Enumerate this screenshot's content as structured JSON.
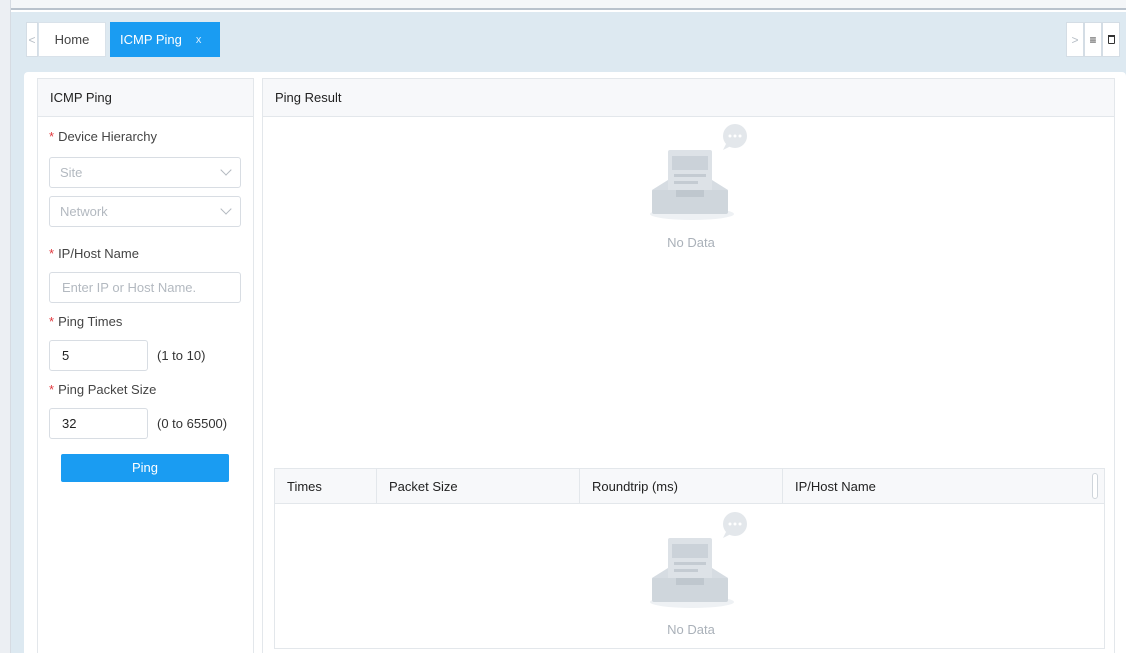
{
  "tabs": {
    "prev_label": "<",
    "next_label": ">",
    "menu_label": "≡",
    "home_label": "Home",
    "active_label": "ICMP Ping",
    "active_close": "x"
  },
  "form": {
    "title": "ICMP Ping",
    "required_mark": "*",
    "device_hierarchy_label": "Device Hierarchy",
    "site_placeholder": "Site",
    "network_placeholder": "Network",
    "ip_label": "IP/Host Name",
    "ip_placeholder": "Enter IP or Host Name.",
    "ping_times_label": "Ping Times",
    "ping_times_value": "5",
    "ping_times_range": "(1 to 10)",
    "packet_size_label": "Ping Packet Size",
    "packet_size_value": "32",
    "packet_size_range": "(0 to 65500)",
    "ping_button": "Ping"
  },
  "result": {
    "title": "Ping Result",
    "no_data": "No Data",
    "columns": [
      "Times",
      "Packet Size",
      "Roundtrip (ms)",
      "IP/Host Name"
    ],
    "table_no_data": "No Data"
  },
  "icons": {
    "empty_state": "empty-inbox-icon",
    "chat_bubble": "chat-bubble-icon",
    "trash": "trash-icon",
    "menu": "menu-icon",
    "chevron": "chevron-down-icon"
  },
  "colors": {
    "accent": "#1a9cf2",
    "required": "#e0393e",
    "tabbar_bg": "#dde9f1"
  }
}
